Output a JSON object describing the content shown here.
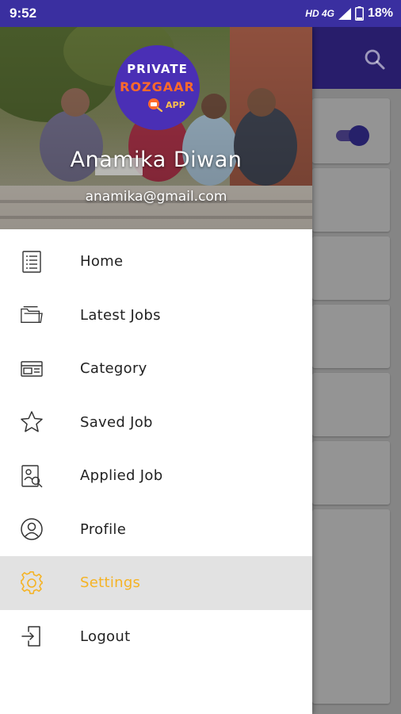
{
  "status_bar": {
    "time": "9:52",
    "network": "HD 4G",
    "battery": "18%"
  },
  "drawer": {
    "logo": {
      "line1": "PRIVATE",
      "line2": "ROZGAAR",
      "line3": "APP"
    },
    "user": {
      "name": "Anamika Diwan",
      "email": "anamika@gmail.com"
    },
    "menu": [
      {
        "label": "Home",
        "icon": "document-list-icon"
      },
      {
        "label": "Latest Jobs",
        "icon": "folder-icon"
      },
      {
        "label": "Category",
        "icon": "card-icon"
      },
      {
        "label": "Saved Job",
        "icon": "star-icon"
      },
      {
        "label": "Applied Job",
        "icon": "search-document-icon"
      },
      {
        "label": "Profile",
        "icon": "user-circle-icon"
      },
      {
        "label": "Settings",
        "icon": "gear-icon",
        "active": true
      },
      {
        "label": "Logout",
        "icon": "logout-icon"
      }
    ]
  },
  "colors": {
    "status_bar": "#3a2fa0",
    "toolbar": "#4633b8",
    "active_item_text": "#f5b324",
    "active_item_bg": "#e2e2e2"
  }
}
